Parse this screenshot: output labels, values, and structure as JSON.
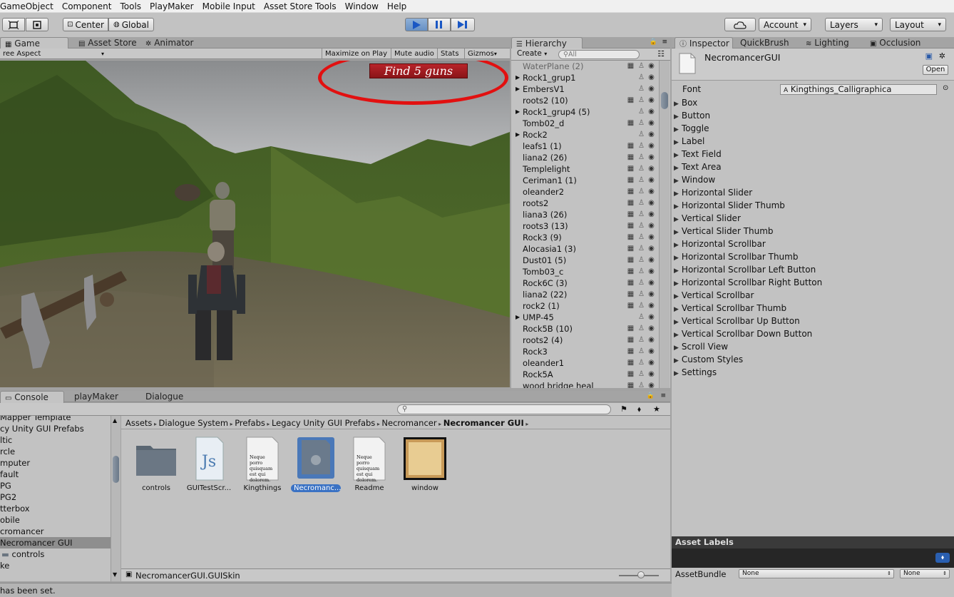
{
  "menubar": {
    "items": [
      "GameObject",
      "Component",
      "Tools",
      "PlayMaker",
      "Mobile Input",
      "Asset Store Tools",
      "Window",
      "Help"
    ]
  },
  "toolbar": {
    "center_label": "Center",
    "global_label": "Global",
    "account_label": "Account",
    "layers_label": "Layers",
    "layout_label": "Layout"
  },
  "game_tabs": {
    "game": "Game",
    "asset_store": "Asset Store",
    "animator": "Animator"
  },
  "game_bar": {
    "aspect": "ree Aspect",
    "maximize": "Maximize on Play",
    "mute": "Mute audio",
    "stats": "Stats",
    "gizmos": "Gizmos"
  },
  "game_overlay": {
    "banner": "Find 5 guns"
  },
  "hierarchy": {
    "tab": "Hierarchy",
    "create": "Create",
    "search_placeholder": "All",
    "items": [
      {
        "name": "WaterPlane (2)",
        "arrow": false,
        "faded": true
      },
      {
        "name": "Rock1_grup1",
        "arrow": true
      },
      {
        "name": "EmbersV1",
        "arrow": true
      },
      {
        "name": "roots2 (10)",
        "arrow": false
      },
      {
        "name": "Rock1_grup4 (5)",
        "arrow": true
      },
      {
        "name": "Tomb02_d",
        "arrow": false
      },
      {
        "name": "Rock2",
        "arrow": true
      },
      {
        "name": "leafs1 (1)",
        "arrow": false
      },
      {
        "name": "liana2 (26)",
        "arrow": false
      },
      {
        "name": "Templelight",
        "arrow": false
      },
      {
        "name": "Ceriman1 (1)",
        "arrow": false
      },
      {
        "name": "oleander2",
        "arrow": false
      },
      {
        "name": "roots2",
        "arrow": false
      },
      {
        "name": "liana3 (26)",
        "arrow": false
      },
      {
        "name": "roots3 (13)",
        "arrow": false
      },
      {
        "name": "Rock3 (9)",
        "arrow": false
      },
      {
        "name": "Alocasia1 (3)",
        "arrow": false
      },
      {
        "name": "Dust01 (5)",
        "arrow": false
      },
      {
        "name": "Tomb03_c",
        "arrow": false
      },
      {
        "name": "Rock6C (3)",
        "arrow": false
      },
      {
        "name": "liana2 (22)",
        "arrow": false
      },
      {
        "name": "rock2 (1)",
        "arrow": false
      },
      {
        "name": "UMP-45",
        "arrow": true
      },
      {
        "name": "Rock5B (10)",
        "arrow": false
      },
      {
        "name": "roots2 (4)",
        "arrow": false
      },
      {
        "name": "Rock3",
        "arrow": false
      },
      {
        "name": "oleander1",
        "arrow": false
      },
      {
        "name": "Rock5A",
        "arrow": false
      },
      {
        "name": "wood bridge heal",
        "arrow": false
      }
    ]
  },
  "inspector": {
    "tabs": [
      "Inspector",
      "QuickBrush",
      "Lighting",
      "Occlusion"
    ],
    "object_name": "NecromancerGUI",
    "open_button": "Open",
    "font_label": "Font",
    "font_value": "Kingthings_Calligraphica",
    "properties": [
      "Box",
      "Button",
      "Toggle",
      "Label",
      "Text Field",
      "Text Area",
      "Window",
      "Horizontal Slider",
      "Horizontal Slider Thumb",
      "Vertical Slider",
      "Vertical Slider Thumb",
      "Horizontal Scrollbar",
      "Horizontal Scrollbar Thumb",
      "Horizontal Scrollbar Left Button",
      "Horizontal Scrollbar Right Button",
      "Vertical Scrollbar",
      "Vertical Scrollbar Thumb",
      "Vertical Scrollbar Up Button",
      "Vertical Scrollbar Down Button",
      "Scroll View",
      "Custom Styles",
      "Settings"
    ],
    "asset_labels": "Asset Labels",
    "asset_bundle": "AssetBundle",
    "none1": "None",
    "none2": "None"
  },
  "bottom_tabs": {
    "console": "Console",
    "playmaker": "playMaker",
    "dialogue": "Dialogue"
  },
  "project": {
    "tree": [
      "Mapper Template",
      "cy Unity GUI Prefabs",
      "ltic",
      "rcle",
      "mputer",
      "fault",
      "PG",
      "PG2",
      "tterbox",
      "obile",
      "cromancer",
      "Necromancer GUI",
      "controls",
      "ke"
    ],
    "breadcrumb": [
      "Assets",
      "Dialogue System",
      "Prefabs",
      "Legacy Unity GUI Prefabs",
      "Necromancer",
      "Necromancer GUI"
    ],
    "assets": [
      {
        "label": "controls"
      },
      {
        "label": "GUITestScr..."
      },
      {
        "label": "Kingthings"
      },
      {
        "label": "Necromanc..."
      },
      {
        "label": "Readme"
      },
      {
        "label": "window"
      }
    ],
    "doc_text": "Neque porro quisquam est qui dolorem.",
    "js_text": "Js",
    "selected_path": "NecromancerGUI.GUISkin"
  },
  "status": {
    "text": "has been set."
  }
}
